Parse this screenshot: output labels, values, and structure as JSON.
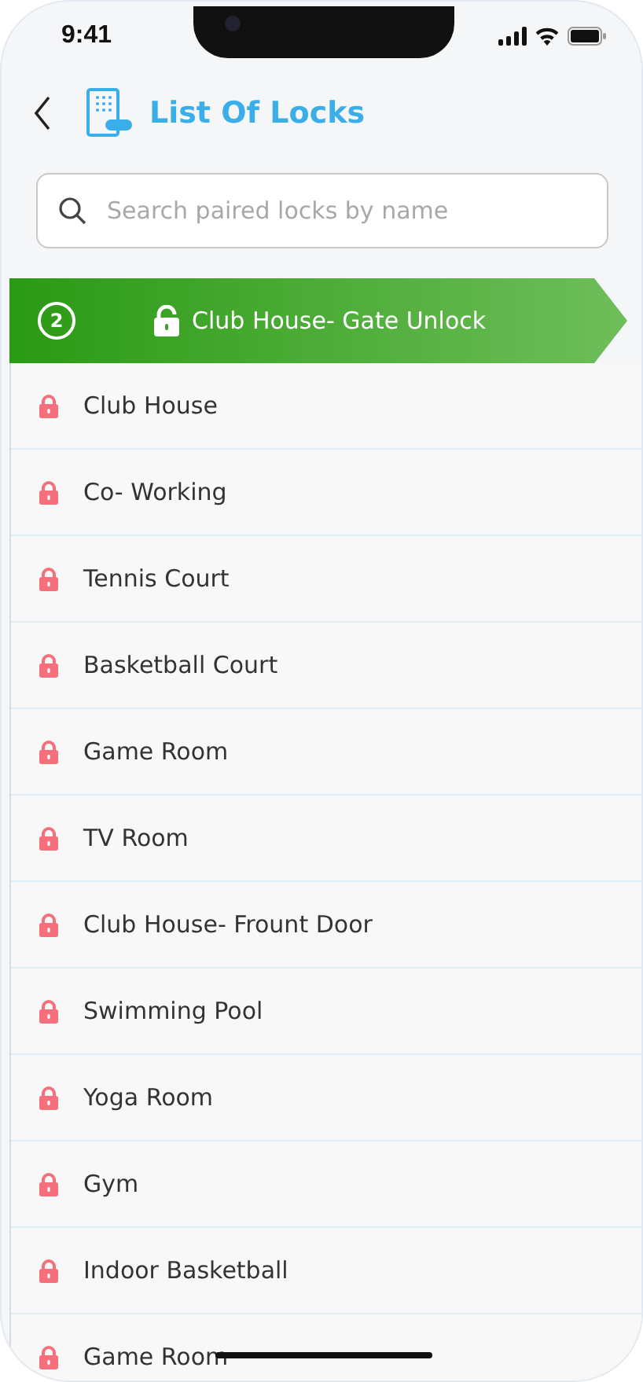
{
  "status_bar": {
    "time": "9:41"
  },
  "header": {
    "title": "List Of Locks"
  },
  "search": {
    "placeholder": "Search paired locks by name"
  },
  "banner": {
    "count": "2",
    "label": "Club House- Gate Unlock",
    "locked": false
  },
  "locks": [
    {
      "name": "Club House",
      "locked": true
    },
    {
      "name": "Co- Working",
      "locked": true
    },
    {
      "name": "Tennis Court",
      "locked": true
    },
    {
      "name": "Basketball Court",
      "locked": true
    },
    {
      "name": "Game Room",
      "locked": true
    },
    {
      "name": "TV Room",
      "locked": true
    },
    {
      "name": "Club House- Frount Door",
      "locked": true
    },
    {
      "name": "Swimming Pool",
      "locked": true
    },
    {
      "name": "Yoga Room",
      "locked": true
    },
    {
      "name": "Gym",
      "locked": true
    },
    {
      "name": "Indoor Basketball",
      "locked": true
    },
    {
      "name": "Game Room",
      "locked": true
    }
  ]
}
